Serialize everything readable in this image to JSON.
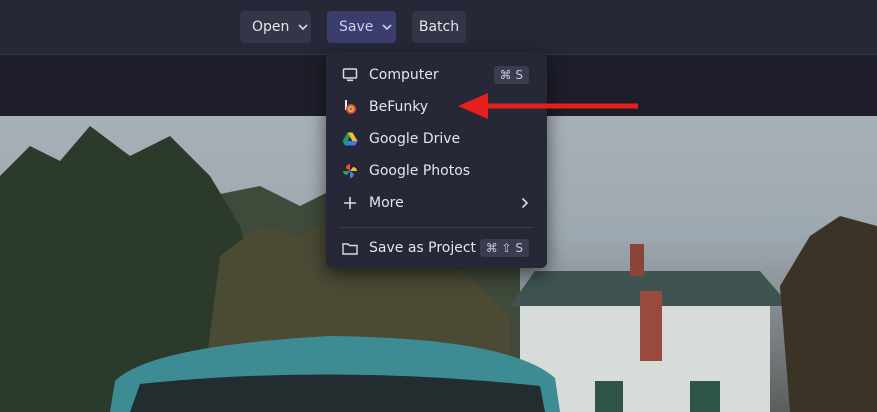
{
  "toolbar": {
    "open_label": "Open",
    "save_label": "Save",
    "batch_label": "Batch"
  },
  "save_menu": {
    "items": [
      {
        "label": "Computer",
        "icon": "monitor-icon",
        "shortcut": "⌘ S"
      },
      {
        "label": "BeFunky",
        "icon": "befunky-logo-icon"
      },
      {
        "label": "Google Drive",
        "icon": "google-drive-icon"
      },
      {
        "label": "Google Photos",
        "icon": "google-photos-icon"
      },
      {
        "label": "More",
        "icon": "plus-icon",
        "submenu": true
      },
      {
        "label": "Save as Project",
        "icon": "folder-icon",
        "shortcut": "⌘ ⇧ S"
      }
    ]
  },
  "colors": {
    "accent_active": "#3b3d6b",
    "annotation_arrow": "#e5201c"
  }
}
